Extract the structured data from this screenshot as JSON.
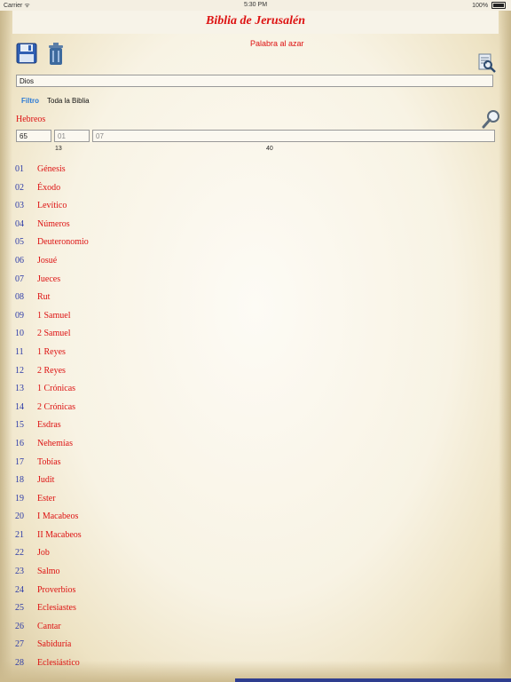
{
  "status_bar": {
    "carrier": "Carrier ᯤ",
    "time": "5:30 PM",
    "battery": "100%"
  },
  "app": {
    "title": "Biblia de Jerusalén"
  },
  "toolbar": {
    "random_word_label": "Palabra al azar"
  },
  "search": {
    "value": "Dios"
  },
  "tabs": [
    {
      "label": "Filtro",
      "active": true
    },
    {
      "label": "Toda la Biblia",
      "active": false
    }
  ],
  "book_header": {
    "label": "Hebreos"
  },
  "fields": {
    "first": {
      "value": "65"
    },
    "second": {
      "placeholder": "01"
    },
    "third": {
      "placeholder": "07"
    }
  },
  "counts": {
    "first": "13",
    "second": "40"
  },
  "books": [
    {
      "num": "01",
      "name": "Génesis"
    },
    {
      "num": "02",
      "name": "Éxodo"
    },
    {
      "num": "03",
      "name": "Levítico"
    },
    {
      "num": "04",
      "name": "Números"
    },
    {
      "num": "05",
      "name": "Deuteronomio"
    },
    {
      "num": "06",
      "name": "Josué"
    },
    {
      "num": "07",
      "name": "Jueces"
    },
    {
      "num": "08",
      "name": "Rut"
    },
    {
      "num": "09",
      "name": "1 Samuel"
    },
    {
      "num": "10",
      "name": "2 Samuel"
    },
    {
      "num": "11",
      "name": "1 Reyes"
    },
    {
      "num": "12",
      "name": "2 Reyes"
    },
    {
      "num": "13",
      "name": "1 Crónicas"
    },
    {
      "num": "14",
      "name": "2 Crónicas"
    },
    {
      "num": "15",
      "name": "Esdras"
    },
    {
      "num": "16",
      "name": "Nehemías"
    },
    {
      "num": "17",
      "name": "Tobías"
    },
    {
      "num": "18",
      "name": "Judit"
    },
    {
      "num": "19",
      "name": "Ester"
    },
    {
      "num": "20",
      "name": "I Macabeos"
    },
    {
      "num": "21",
      "name": "II Macabeos"
    },
    {
      "num": "22",
      "name": "Job"
    },
    {
      "num": "23",
      "name": "Salmo"
    },
    {
      "num": "24",
      "name": "Proverbios"
    },
    {
      "num": "25",
      "name": "Eclesiastes"
    },
    {
      "num": "26",
      "name": "Cantar"
    },
    {
      "num": "27",
      "name": "Sabiduría"
    },
    {
      "num": "28",
      "name": "Eclesiástico"
    }
  ],
  "colors": {
    "accent_red": "#dd1111",
    "number_blue": "#2b3aa8",
    "tab_blue": "#2a7ad6"
  }
}
